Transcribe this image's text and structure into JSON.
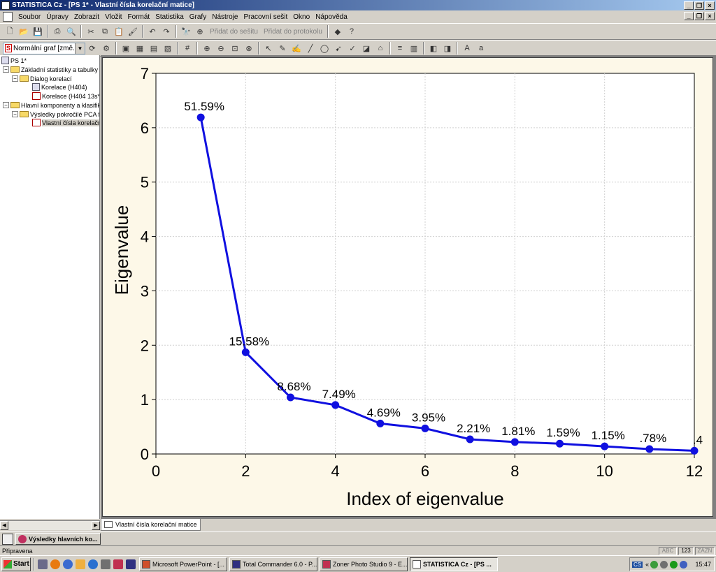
{
  "window": {
    "title": "STATISTICA Cz - [PS 1* - Vlastní čísla  korelační matice]"
  },
  "menu": [
    "Soubor",
    "Úpravy",
    "Zobrazit",
    "Vložit",
    "Formát",
    "Statistika",
    "Grafy",
    "Nástroje",
    "Pracovní sešit",
    "Okno",
    "Nápověda"
  ],
  "toolbar1": {
    "add_to_workbook": "Přidat do sešitu",
    "add_to_report": "Přidat do protokolu"
  },
  "toolbar2": {
    "graph_style": "Normální graf [změ..."
  },
  "tree": {
    "items": [
      "PS 1*",
      "Základní statistiky a tabulky (",
      "Dialog korelací",
      "Korelace (H404)",
      "Korelace (H404 13s*",
      "Hlavní komponenty a klasifika",
      "Výsledky pokročilé PCA f",
      "Vlastní čísla  korelační"
    ]
  },
  "sheet_tab": "Vlastní čísla  korelační matice",
  "task_window": "Výsledky hlavních ko...",
  "status": {
    "text": "Připravena",
    "abc": "ABC",
    "num": "123",
    "rec": "ZÁZN"
  },
  "taskbar": {
    "start": "Start",
    "tasks": [
      "Microsoft PowerPoint - [...",
      "Total Commander 6.0 - P...",
      "Zoner Photo Studio 9 - E...",
      "STATISTICA Cz - [PS ..."
    ],
    "clock": "15:47",
    "lang": "CS"
  },
  "colors": {
    "series": "#1010e0",
    "plot_bg": "#ffffff",
    "window_bg": "#fdf8e8"
  },
  "chart_data": {
    "type": "line",
    "title": "",
    "xlabel": "Index of eigenvalue",
    "ylabel": "Eigenvalue",
    "xlim": [
      0,
      12
    ],
    "ylim": [
      0,
      7
    ],
    "xticks": [
      0,
      2,
      4,
      6,
      8,
      10,
      12
    ],
    "yticks": [
      0,
      1,
      2,
      3,
      4,
      5,
      6,
      7
    ],
    "grid": true,
    "x": [
      1,
      2,
      3,
      4,
      5,
      6,
      7,
      8,
      9,
      10,
      11,
      12
    ],
    "y": [
      6.19,
      1.87,
      1.04,
      0.9,
      0.56,
      0.47,
      0.27,
      0.22,
      0.19,
      0.14,
      0.09,
      0.06
    ],
    "point_labels": [
      "51.59%",
      "15.58%",
      "8.68%",
      "7.49%",
      "4.69%",
      "3.95%",
      "2.21%",
      "1.81%",
      "1.59%",
      "1.15%",
      ".78%",
      ".4"
    ]
  }
}
